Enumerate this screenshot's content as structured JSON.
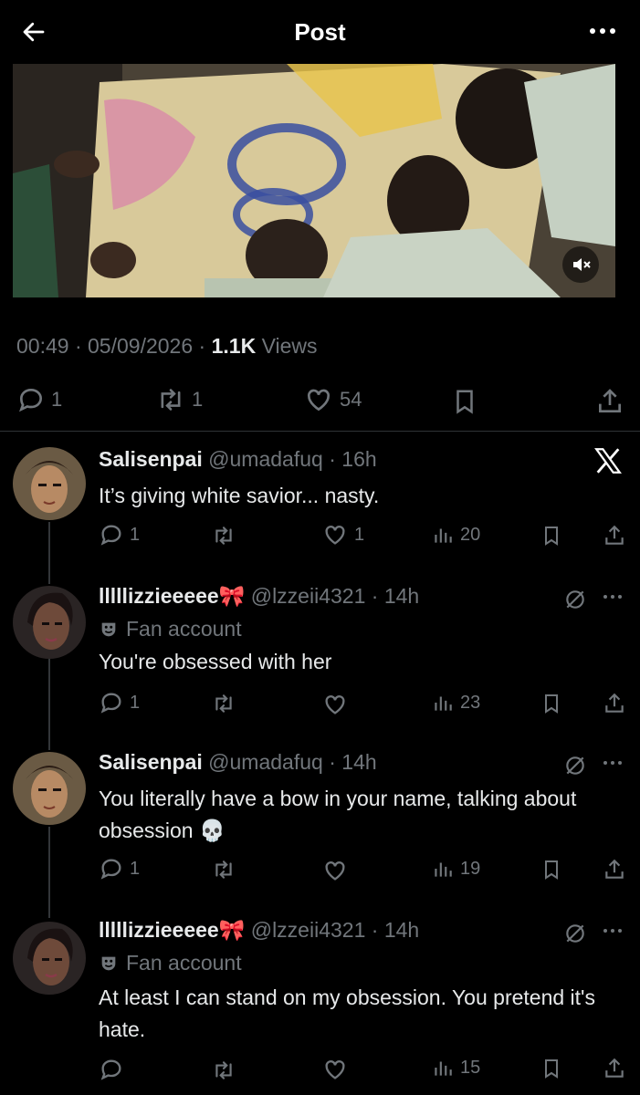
{
  "header": {
    "title": "Post"
  },
  "post": {
    "time": "00:49",
    "date": "05/09/2026",
    "views_count": "1.1K",
    "views_label": "Views",
    "replies": "1",
    "reposts": "1",
    "likes": "54"
  },
  "replies": [
    {
      "name": "Salisenpai",
      "handle": "@umadafuq",
      "time": "16h",
      "text": "It’s giving white savior... nasty.",
      "reply_count": "1",
      "repost_count": "",
      "like_count": "1",
      "views": "20"
    },
    {
      "name": "lllllizzieeeee🎀",
      "handle": "@lzzeii4321",
      "time": "14h",
      "badge": "Fan account",
      "text": "You're obsessed with her",
      "reply_count": "1",
      "repost_count": "",
      "like_count": "",
      "views": "23"
    },
    {
      "name": "Salisenpai",
      "handle": "@umadafuq",
      "time": "14h",
      "text": "You literally have a bow in your name, talking about obsession 💀",
      "reply_count": "1",
      "repost_count": "",
      "like_count": "",
      "views": "19"
    },
    {
      "name": "lllllizzieeeee🎀",
      "handle": "@lzzeii4321",
      "time": "14h",
      "badge": "Fan account",
      "text": "At least I can stand on my obsession. You pretend it's hate.",
      "reply_count": "",
      "repost_count": "",
      "like_count": "",
      "views": "15"
    }
  ],
  "icons": {
    "back": "arrow-left-icon",
    "more": "more-horizontal-icon",
    "mute": "volume-muted-icon",
    "reply": "reply-icon",
    "repost": "repost-icon",
    "like": "heart-icon",
    "views": "views-icon",
    "bookmark": "bookmark-icon",
    "share": "share-icon",
    "x": "x-logo-icon",
    "grok": "grok-icon"
  },
  "colors": {
    "background": "#000000",
    "text": "#e7e9ea",
    "muted": "#71767b"
  }
}
